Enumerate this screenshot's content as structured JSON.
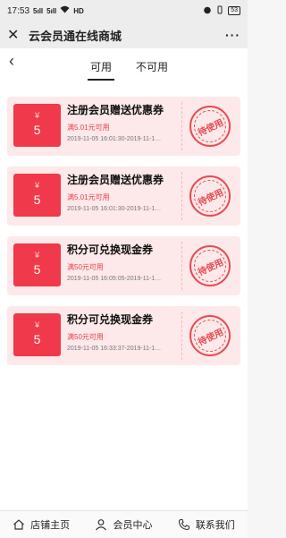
{
  "status_bar": {
    "time": "17:53",
    "signal1": "5ıll",
    "signal2": "5ıll",
    "network": "HD",
    "battery": "53"
  },
  "titlebar": {
    "title": "云会员通在线商城",
    "more": "···"
  },
  "tabs": [
    {
      "label": "可用"
    },
    {
      "label": "不可用"
    }
  ],
  "coupons": [
    {
      "currency": "¥",
      "amount": "5",
      "name": "注册会员赠送优惠券",
      "condition": "满5.01元可用",
      "time": "2019-11-05 16:01:30-2019-11-1…",
      "stamp": "待使用"
    },
    {
      "currency": "¥",
      "amount": "5",
      "name": "注册会员赠送优惠券",
      "condition": "满5.01元可用",
      "time": "2019-11-05 16:01:30-2019-11-1…",
      "stamp": "待使用"
    },
    {
      "currency": "¥",
      "amount": "5",
      "name": "积分可兑换现金券",
      "condition": "满50元可用",
      "time": "2019-11-05 16:05:05-2019-11-1…",
      "stamp": "待使用"
    },
    {
      "currency": "¥",
      "amount": "5",
      "name": "积分可兑换现金券",
      "condition": "满50元可用",
      "time": "2019-11-05 16:33:37-2019-11-1…",
      "stamp": "待使用"
    }
  ],
  "bottom_nav": [
    {
      "label": "店铺主页",
      "icon": "home-icon"
    },
    {
      "label": "会员中心",
      "icon": "user-icon"
    },
    {
      "label": "联系我们",
      "icon": "phone-icon"
    }
  ],
  "colors": {
    "accent": "#f0394a",
    "coupon_bg": "#fde9e9"
  }
}
